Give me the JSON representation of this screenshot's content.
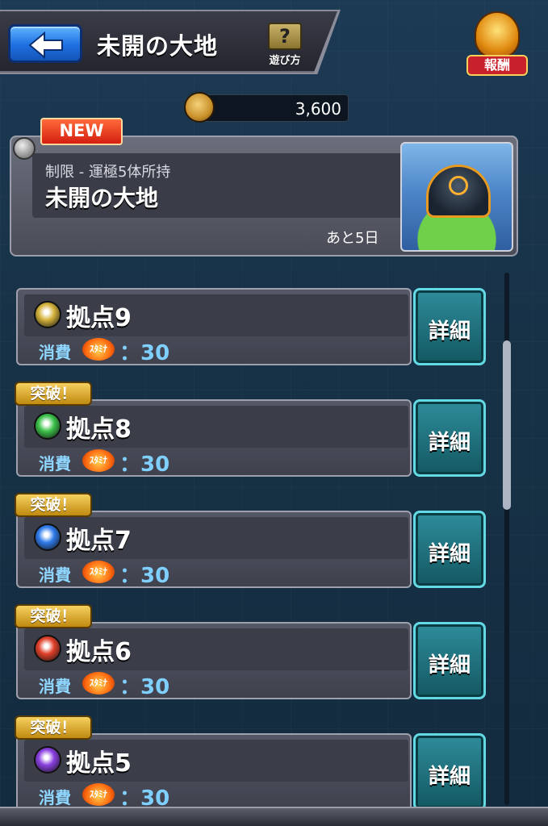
{
  "header": {
    "title": "未開の大地",
    "help_label": "遊び方",
    "help_glyph": "?",
    "reward_label": "報酬"
  },
  "currency": {
    "value": "3,600"
  },
  "event": {
    "badge": "NEW",
    "condition": "制限 - 運極5体所持",
    "title": "未開の大地",
    "remaining": "あと5日"
  },
  "stages": [
    {
      "name": "拠点9",
      "cost_label": "消費",
      "stamina_label": "ｽﾀﾐﾅ",
      "cost": "：30",
      "detail": "詳細",
      "badge": "",
      "element_color": "#d4b23a"
    },
    {
      "name": "拠点8",
      "cost_label": "消費",
      "stamina_label": "ｽﾀﾐﾅ",
      "cost": "：30",
      "detail": "詳細",
      "badge": "突破！",
      "element_color": "#3cc24a"
    },
    {
      "name": "拠点7",
      "cost_label": "消費",
      "stamina_label": "ｽﾀﾐﾅ",
      "cost": "：30",
      "detail": "詳細",
      "badge": "突破！",
      "element_color": "#2f7bea"
    },
    {
      "name": "拠点6",
      "cost_label": "消費",
      "stamina_label": "ｽﾀﾐﾅ",
      "cost": "：30",
      "detail": "詳細",
      "badge": "突破！",
      "element_color": "#e0402a"
    },
    {
      "name": "拠点5",
      "cost_label": "消費",
      "stamina_label": "ｽﾀﾐﾅ",
      "cost": "：30",
      "detail": "詳細",
      "badge": "突破！",
      "element_color": "#8a40e0"
    }
  ]
}
